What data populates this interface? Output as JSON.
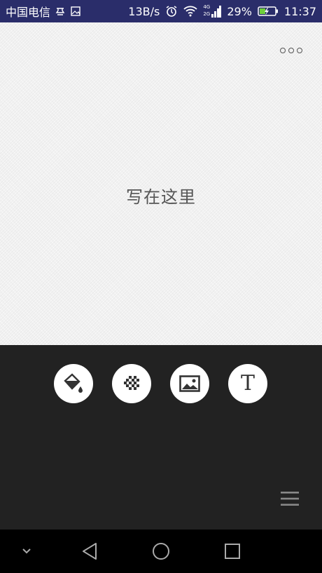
{
  "status_bar": {
    "carrier": "中国电信",
    "speed": "13B/s",
    "signal_label_top": "4G",
    "signal_label_bottom": "2G",
    "battery": "29%",
    "time": "11:37"
  },
  "canvas": {
    "placeholder": "写在这里",
    "more_icon": "more-horizontal-icon"
  },
  "tools": [
    {
      "icon": "paint-bucket-icon"
    },
    {
      "icon": "mosaic-pattern-icon"
    },
    {
      "icon": "image-icon"
    },
    {
      "icon": "text-icon",
      "label": "T"
    }
  ],
  "menu_icon": "hamburger-menu-icon",
  "nav": [
    "collapse",
    "back",
    "home",
    "recents"
  ],
  "colors": {
    "status_bar": "#2a2d6a",
    "panel": "#222222",
    "nav_bar": "#000000",
    "battery_fill": "#6ecf3a"
  }
}
